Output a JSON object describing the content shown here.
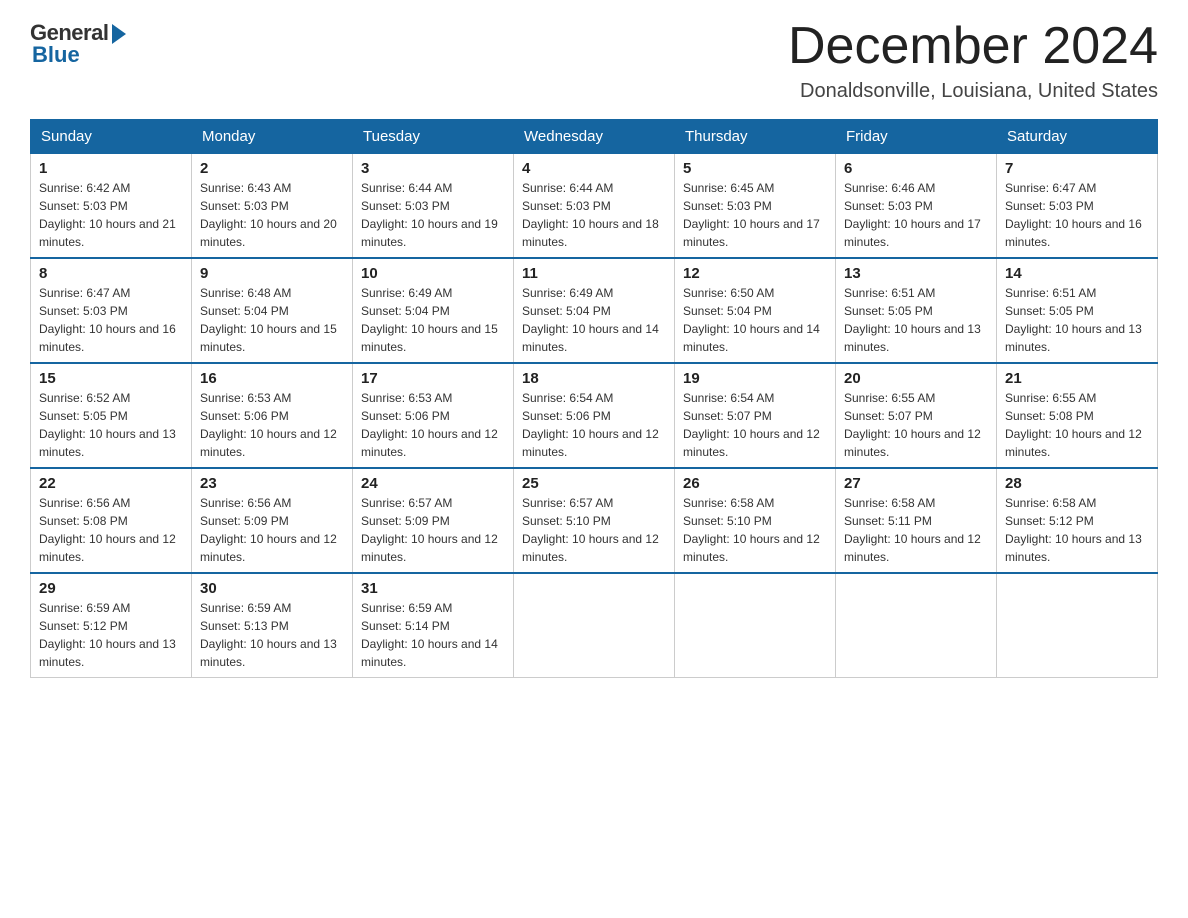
{
  "header": {
    "logo_general": "General",
    "logo_blue": "Blue",
    "month_year": "December 2024",
    "location": "Donaldsonville, Louisiana, United States"
  },
  "days_of_week": [
    "Sunday",
    "Monday",
    "Tuesday",
    "Wednesday",
    "Thursday",
    "Friday",
    "Saturday"
  ],
  "weeks": [
    [
      {
        "day": "1",
        "sunrise": "6:42 AM",
        "sunset": "5:03 PM",
        "daylight": "10 hours and 21 minutes."
      },
      {
        "day": "2",
        "sunrise": "6:43 AM",
        "sunset": "5:03 PM",
        "daylight": "10 hours and 20 minutes."
      },
      {
        "day": "3",
        "sunrise": "6:44 AM",
        "sunset": "5:03 PM",
        "daylight": "10 hours and 19 minutes."
      },
      {
        "day": "4",
        "sunrise": "6:44 AM",
        "sunset": "5:03 PM",
        "daylight": "10 hours and 18 minutes."
      },
      {
        "day": "5",
        "sunrise": "6:45 AM",
        "sunset": "5:03 PM",
        "daylight": "10 hours and 17 minutes."
      },
      {
        "day": "6",
        "sunrise": "6:46 AM",
        "sunset": "5:03 PM",
        "daylight": "10 hours and 17 minutes."
      },
      {
        "day": "7",
        "sunrise": "6:47 AM",
        "sunset": "5:03 PM",
        "daylight": "10 hours and 16 minutes."
      }
    ],
    [
      {
        "day": "8",
        "sunrise": "6:47 AM",
        "sunset": "5:03 PM",
        "daylight": "10 hours and 16 minutes."
      },
      {
        "day": "9",
        "sunrise": "6:48 AM",
        "sunset": "5:04 PM",
        "daylight": "10 hours and 15 minutes."
      },
      {
        "day": "10",
        "sunrise": "6:49 AM",
        "sunset": "5:04 PM",
        "daylight": "10 hours and 15 minutes."
      },
      {
        "day": "11",
        "sunrise": "6:49 AM",
        "sunset": "5:04 PM",
        "daylight": "10 hours and 14 minutes."
      },
      {
        "day": "12",
        "sunrise": "6:50 AM",
        "sunset": "5:04 PM",
        "daylight": "10 hours and 14 minutes."
      },
      {
        "day": "13",
        "sunrise": "6:51 AM",
        "sunset": "5:05 PM",
        "daylight": "10 hours and 13 minutes."
      },
      {
        "day": "14",
        "sunrise": "6:51 AM",
        "sunset": "5:05 PM",
        "daylight": "10 hours and 13 minutes."
      }
    ],
    [
      {
        "day": "15",
        "sunrise": "6:52 AM",
        "sunset": "5:05 PM",
        "daylight": "10 hours and 13 minutes."
      },
      {
        "day": "16",
        "sunrise": "6:53 AM",
        "sunset": "5:06 PM",
        "daylight": "10 hours and 12 minutes."
      },
      {
        "day": "17",
        "sunrise": "6:53 AM",
        "sunset": "5:06 PM",
        "daylight": "10 hours and 12 minutes."
      },
      {
        "day": "18",
        "sunrise": "6:54 AM",
        "sunset": "5:06 PM",
        "daylight": "10 hours and 12 minutes."
      },
      {
        "day": "19",
        "sunrise": "6:54 AM",
        "sunset": "5:07 PM",
        "daylight": "10 hours and 12 minutes."
      },
      {
        "day": "20",
        "sunrise": "6:55 AM",
        "sunset": "5:07 PM",
        "daylight": "10 hours and 12 minutes."
      },
      {
        "day": "21",
        "sunrise": "6:55 AM",
        "sunset": "5:08 PM",
        "daylight": "10 hours and 12 minutes."
      }
    ],
    [
      {
        "day": "22",
        "sunrise": "6:56 AM",
        "sunset": "5:08 PM",
        "daylight": "10 hours and 12 minutes."
      },
      {
        "day": "23",
        "sunrise": "6:56 AM",
        "sunset": "5:09 PM",
        "daylight": "10 hours and 12 minutes."
      },
      {
        "day": "24",
        "sunrise": "6:57 AM",
        "sunset": "5:09 PM",
        "daylight": "10 hours and 12 minutes."
      },
      {
        "day": "25",
        "sunrise": "6:57 AM",
        "sunset": "5:10 PM",
        "daylight": "10 hours and 12 minutes."
      },
      {
        "day": "26",
        "sunrise": "6:58 AM",
        "sunset": "5:10 PM",
        "daylight": "10 hours and 12 minutes."
      },
      {
        "day": "27",
        "sunrise": "6:58 AM",
        "sunset": "5:11 PM",
        "daylight": "10 hours and 12 minutes."
      },
      {
        "day": "28",
        "sunrise": "6:58 AM",
        "sunset": "5:12 PM",
        "daylight": "10 hours and 13 minutes."
      }
    ],
    [
      {
        "day": "29",
        "sunrise": "6:59 AM",
        "sunset": "5:12 PM",
        "daylight": "10 hours and 13 minutes."
      },
      {
        "day": "30",
        "sunrise": "6:59 AM",
        "sunset": "5:13 PM",
        "daylight": "10 hours and 13 minutes."
      },
      {
        "day": "31",
        "sunrise": "6:59 AM",
        "sunset": "5:14 PM",
        "daylight": "10 hours and 14 minutes."
      },
      null,
      null,
      null,
      null
    ]
  ]
}
